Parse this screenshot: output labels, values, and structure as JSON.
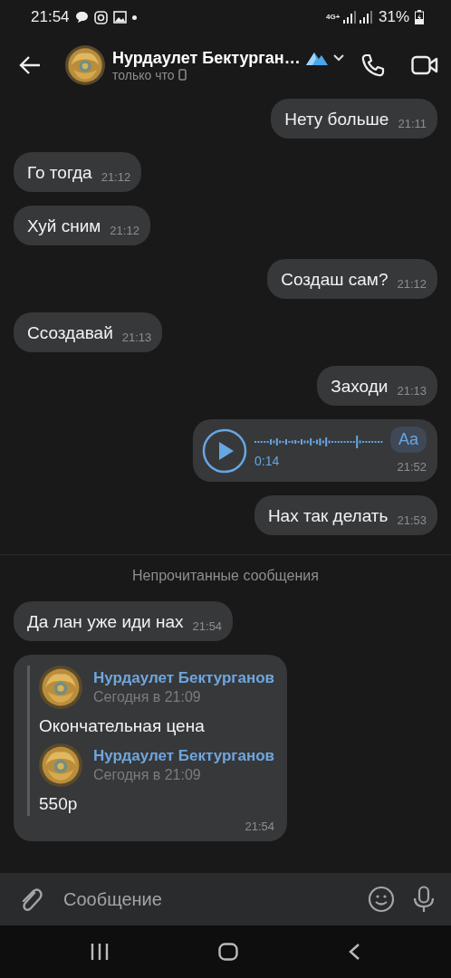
{
  "status_bar": {
    "time": "21:54",
    "network": "4G+",
    "battery": "31%"
  },
  "header": {
    "name": "Нурдаулет Бектурган…",
    "status": "только что"
  },
  "messages": [
    {
      "kind": "text",
      "outgoing": true,
      "text": "Нету больше",
      "time": "21:11"
    },
    {
      "kind": "text",
      "outgoing": false,
      "text": "Го тогда",
      "time": "21:12"
    },
    {
      "kind": "text",
      "outgoing": false,
      "text": "Хуй сним",
      "time": "21:12"
    },
    {
      "kind": "text",
      "outgoing": true,
      "text": "Создаш сам?",
      "time": "21:12"
    },
    {
      "kind": "text",
      "outgoing": false,
      "text": "Ссоздавай",
      "time": "21:13"
    },
    {
      "kind": "text",
      "outgoing": true,
      "text": "Заходи",
      "time": "21:13"
    },
    {
      "kind": "voice",
      "outgoing": true,
      "duration": "0:14",
      "transcribe": "Aa",
      "time": "21:52"
    },
    {
      "kind": "text",
      "outgoing": true,
      "text": "Нах так делать",
      "time": "21:53"
    },
    {
      "kind": "divider",
      "text": "Непрочитанные сообщения"
    },
    {
      "kind": "text",
      "outgoing": false,
      "text": "Да лан уже иди нах",
      "time": "21:54"
    },
    {
      "kind": "forward",
      "outgoing": false,
      "time": "21:54",
      "items": [
        {
          "author": "Нурдаулет Бектурганов",
          "date": "Сегодня в 21:09",
          "text": "Окончательная цена"
        },
        {
          "author": "Нурдаулет Бектурганов",
          "date": "Сегодня в 21:09",
          "text": "550р"
        }
      ]
    }
  ],
  "composer": {
    "placeholder": "Сообщение"
  }
}
